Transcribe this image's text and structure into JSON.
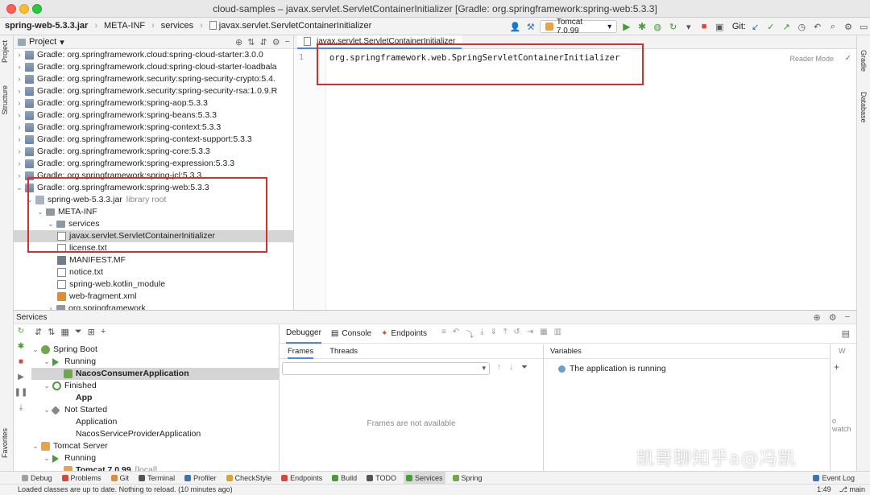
{
  "window": {
    "title": "cloud-samples – javax.servlet.ServletContainerInitializer [Gradle: org.springframework:spring-web:5.3.3]"
  },
  "breadcrumb": [
    "spring-web-5.3.3.jar",
    "META-INF",
    "services",
    "javax.servlet.ServletContainerInitializer"
  ],
  "toolbar": {
    "run_config": "Tomcat 7.0.99",
    "git_label": "Git:"
  },
  "sidebar_left": {
    "project_tab": "Project",
    "structure_tab": "Structure",
    "favorites_tab": "Favorites"
  },
  "sidebar_right": {
    "gradle_tab": "Gradle",
    "database_tab": "Database"
  },
  "project": {
    "header": "Project",
    "rows": [
      "Gradle: org.springframework.cloud:spring-cloud-starter:3.0.0",
      "Gradle: org.springframework.cloud:spring-cloud-starter-loadbala",
      "Gradle: org.springframework.security:spring-security-crypto:5.4.",
      "Gradle: org.springframework.security:spring-security-rsa:1.0.9.R",
      "Gradle: org.springframework:spring-aop:5.3.3",
      "Gradle: org.springframework:spring-beans:5.3.3",
      "Gradle: org.springframework:spring-context:5.3.3",
      "Gradle: org.springframework:spring-context-support:5.3.3",
      "Gradle: org.springframework:spring-core:5.3.3",
      "Gradle: org.springframework:spring-expression:5.3.3",
      "Gradle: org.springframework:spring-jcl:5.3.3",
      "Gradle: org.springframework:spring-web:5.3.3",
      "spring-web-5.3.3.jar",
      "META-INF",
      "services",
      "javax.servlet.ServletContainerInitializer",
      "license.txt",
      "MANIFEST.MF",
      "notice.txt",
      "spring-web.kotlin_module",
      "web-fragment.xml",
      "org.springframework"
    ],
    "library_root": "library root"
  },
  "editor": {
    "tab_label": "javax.servlet.ServletContainerInitializer",
    "line_number": "1",
    "code_line": "org.springframework.web.SpringServletContainerInitializer",
    "reader_mode": "Reader Mode"
  },
  "services": {
    "title": "Services",
    "tree": [
      "Spring Boot",
      "Running",
      "NacosConsumerApplication",
      "Finished",
      "App",
      "Not Started",
      "Application",
      "NacosServiceProviderApplication",
      "Tomcat Server",
      "Running",
      "Tomcat 7.0.99"
    ],
    "tomcat_suffix": "[local]",
    "debug_tabs": [
      "Debugger",
      "Console",
      "Endpoints"
    ],
    "frames_tab": "Frames",
    "threads_tab": "Threads",
    "frames_empty": "Frames are not available",
    "variables_label": "Variables",
    "variables_msg": "The application is running",
    "watches_v": "W",
    "watches_text": "o watch"
  },
  "bottom_tabs": [
    "Debug",
    "Problems",
    "Git",
    "Terminal",
    "Profiler",
    "CheckStyle",
    "Endpoints",
    "Build",
    "TODO",
    "Services",
    "Spring"
  ],
  "event_log": "Event Log",
  "status": {
    "message": "Loaded classes are up to date. Nothing to reload. (10 minutes ago)",
    "position": "1:49",
    "branch": "main"
  },
  "watermark": "凯哥聊知乎a@冯凯",
  "colors": {
    "highlight_red": "#d42f2f",
    "accent_blue": "#4a86e8",
    "run_green": "#4a9b3a"
  }
}
